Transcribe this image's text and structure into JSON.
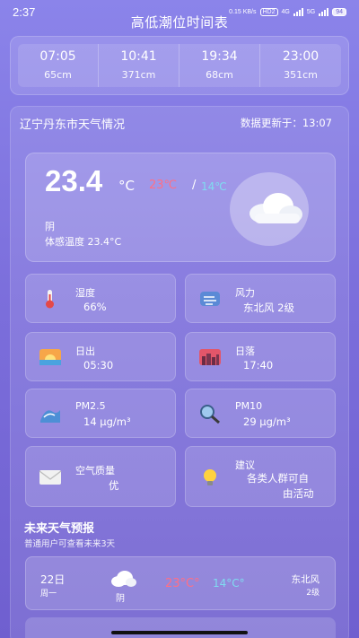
{
  "status_bar": {
    "time": "2:37",
    "net_speed": "0.15 KB/s",
    "hd": "HD2",
    "network": "4G",
    "network2": "5G",
    "battery": "94"
  },
  "page": {
    "title": "高低潮位时间表"
  },
  "tides": [
    {
      "time": "07:05",
      "height": "65cm"
    },
    {
      "time": "10:41",
      "height": "371cm"
    },
    {
      "time": "19:34",
      "height": "68cm"
    },
    {
      "time": "23:00",
      "height": "351cm"
    }
  ],
  "weather": {
    "title": "辽宁丹东市天气情况",
    "update_label": "数据更新于：",
    "update_time": "13:07",
    "current_temp": "23.4",
    "unit": "°C",
    "high": "23℃",
    "low": "14℃",
    "separator": "/",
    "condition": "阴",
    "feels_like": "体感温度 23.4°C"
  },
  "tiles": {
    "humidity": {
      "label": "湿度",
      "value": "66%"
    },
    "wind": {
      "label": "风力",
      "value": "东北风 2级"
    },
    "sunrise": {
      "label": "日出",
      "value": "05:30"
    },
    "sunset": {
      "label": "日落",
      "value": "17:40"
    },
    "pm25": {
      "label": "PM2.5",
      "value": "14 µg/m³"
    },
    "pm10": {
      "label": "PM10",
      "value": "29 µg/m³"
    },
    "aqi": {
      "label": "空气质量",
      "value": "优"
    },
    "advice": {
      "label": "建议",
      "value_line1": "各类人群可自",
      "value_line2": "由活动"
    }
  },
  "forecast": {
    "title": "未来天气预报",
    "subtitle": "普通用户可查看未来3天",
    "days": [
      {
        "date": "22日",
        "weekday": "周一",
        "condition": "阴",
        "high": "23°C°",
        "low": "14°C°",
        "wind": "东北风",
        "level": "2级"
      }
    ]
  },
  "colors": {
    "background_top": "#8b84ea",
    "background_bottom": "#6f5fcf",
    "high_temp": "#ff6f86",
    "low_temp": "#7fdcf0"
  }
}
